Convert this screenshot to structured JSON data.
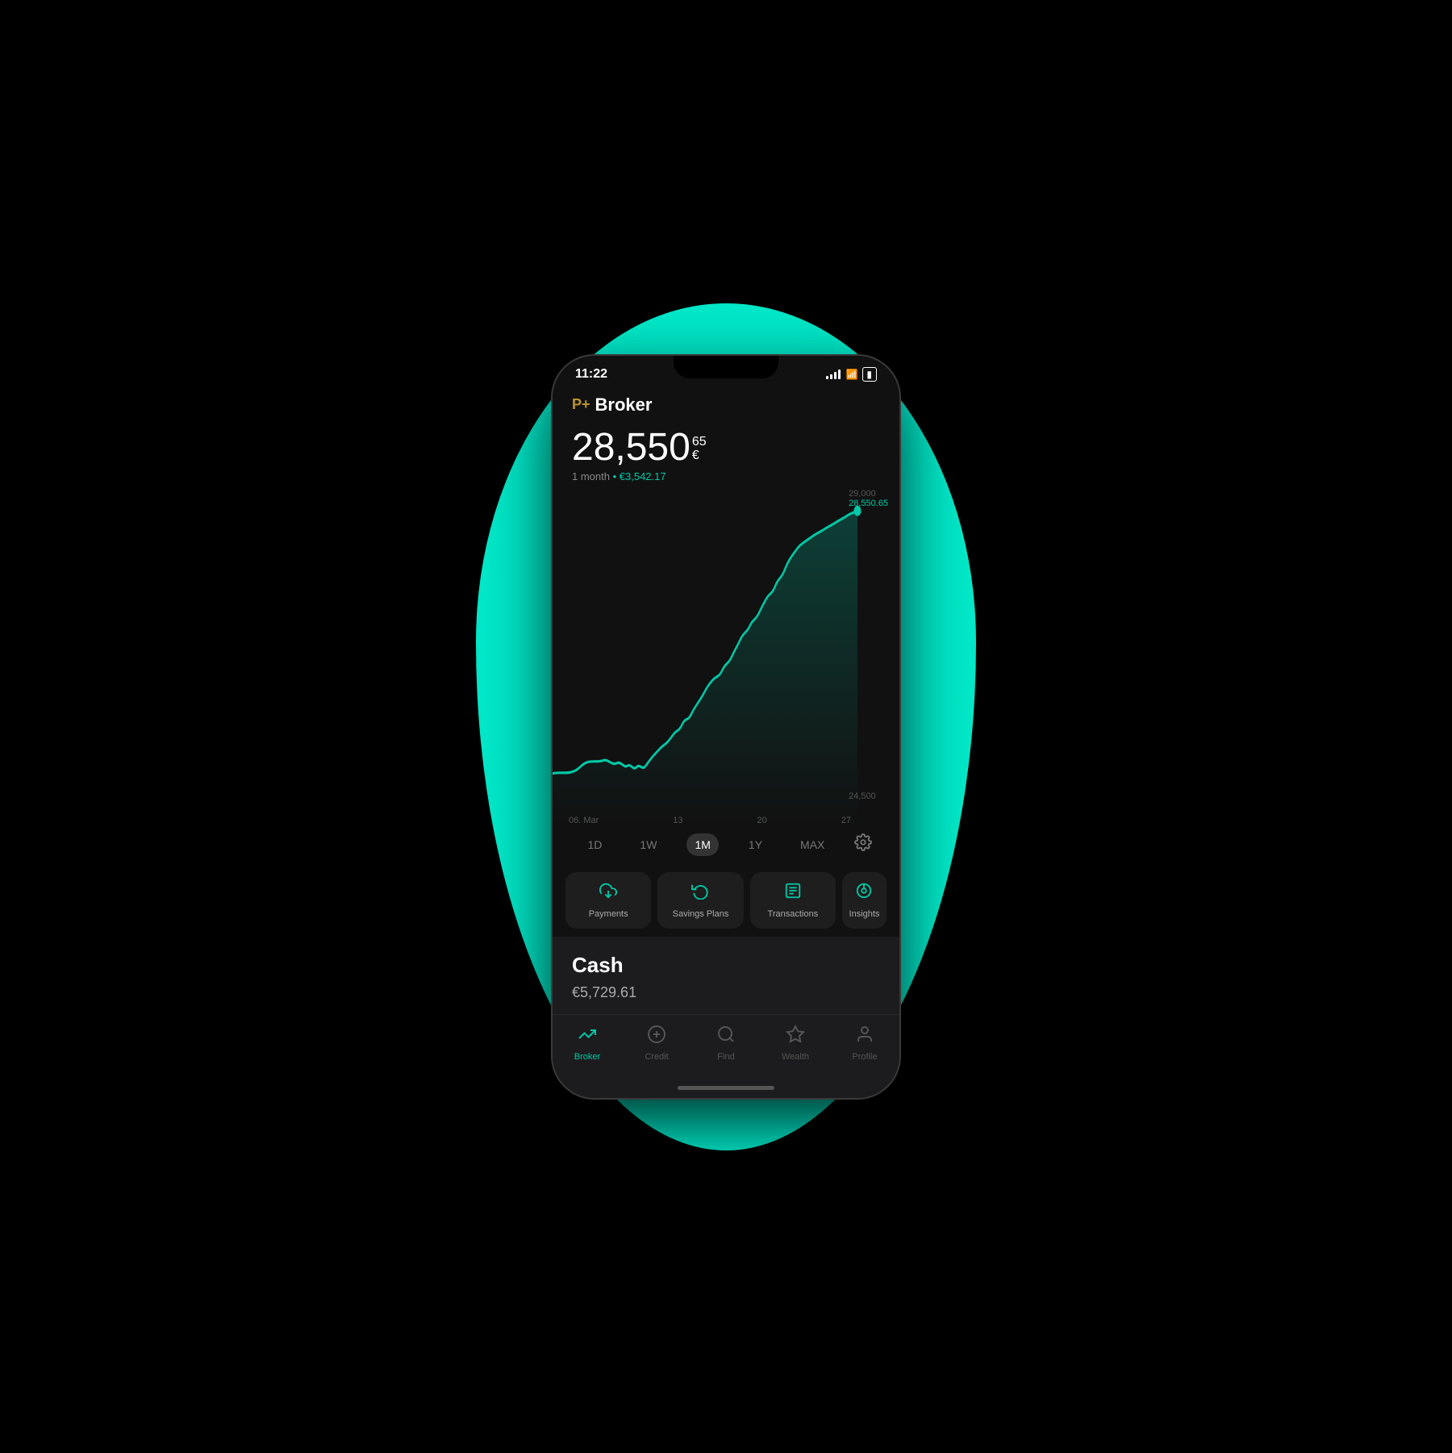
{
  "statusBar": {
    "time": "11:22"
  },
  "header": {
    "brandLogo": "P+",
    "brandName": "Broker"
  },
  "balance": {
    "main": "28,550",
    "superscript_cents": "65",
    "superscript_currency": "€",
    "period": "1 month",
    "change": "• €3,542.17"
  },
  "chart": {
    "label_top": "29,000",
    "label_current": "28,550.65",
    "label_bottom": "24,500",
    "x_labels": [
      "06. Mar",
      "13",
      "20",
      "27"
    ]
  },
  "timeRange": {
    "buttons": [
      "1D",
      "1W",
      "1M",
      "1Y",
      "MAX"
    ],
    "active": "1M"
  },
  "actionButtons": [
    {
      "icon": "↓",
      "label": "Payments"
    },
    {
      "icon": "↺",
      "label": "Savings Plans"
    },
    {
      "icon": "≡",
      "label": "Transactions"
    },
    {
      "icon": "◎",
      "label": "Insights"
    }
  ],
  "cashPanel": {
    "title": "Cash",
    "amount": "€5,729.61"
  },
  "bottomNav": [
    {
      "icon": "📈",
      "label": "Broker",
      "active": true
    },
    {
      "icon": "⊕",
      "label": "Credit",
      "active": false
    },
    {
      "icon": "🔍",
      "label": "Find",
      "active": false
    },
    {
      "icon": "⬡",
      "label": "Wealth",
      "active": false
    },
    {
      "icon": "👤",
      "label": "Profile",
      "active": false
    }
  ]
}
